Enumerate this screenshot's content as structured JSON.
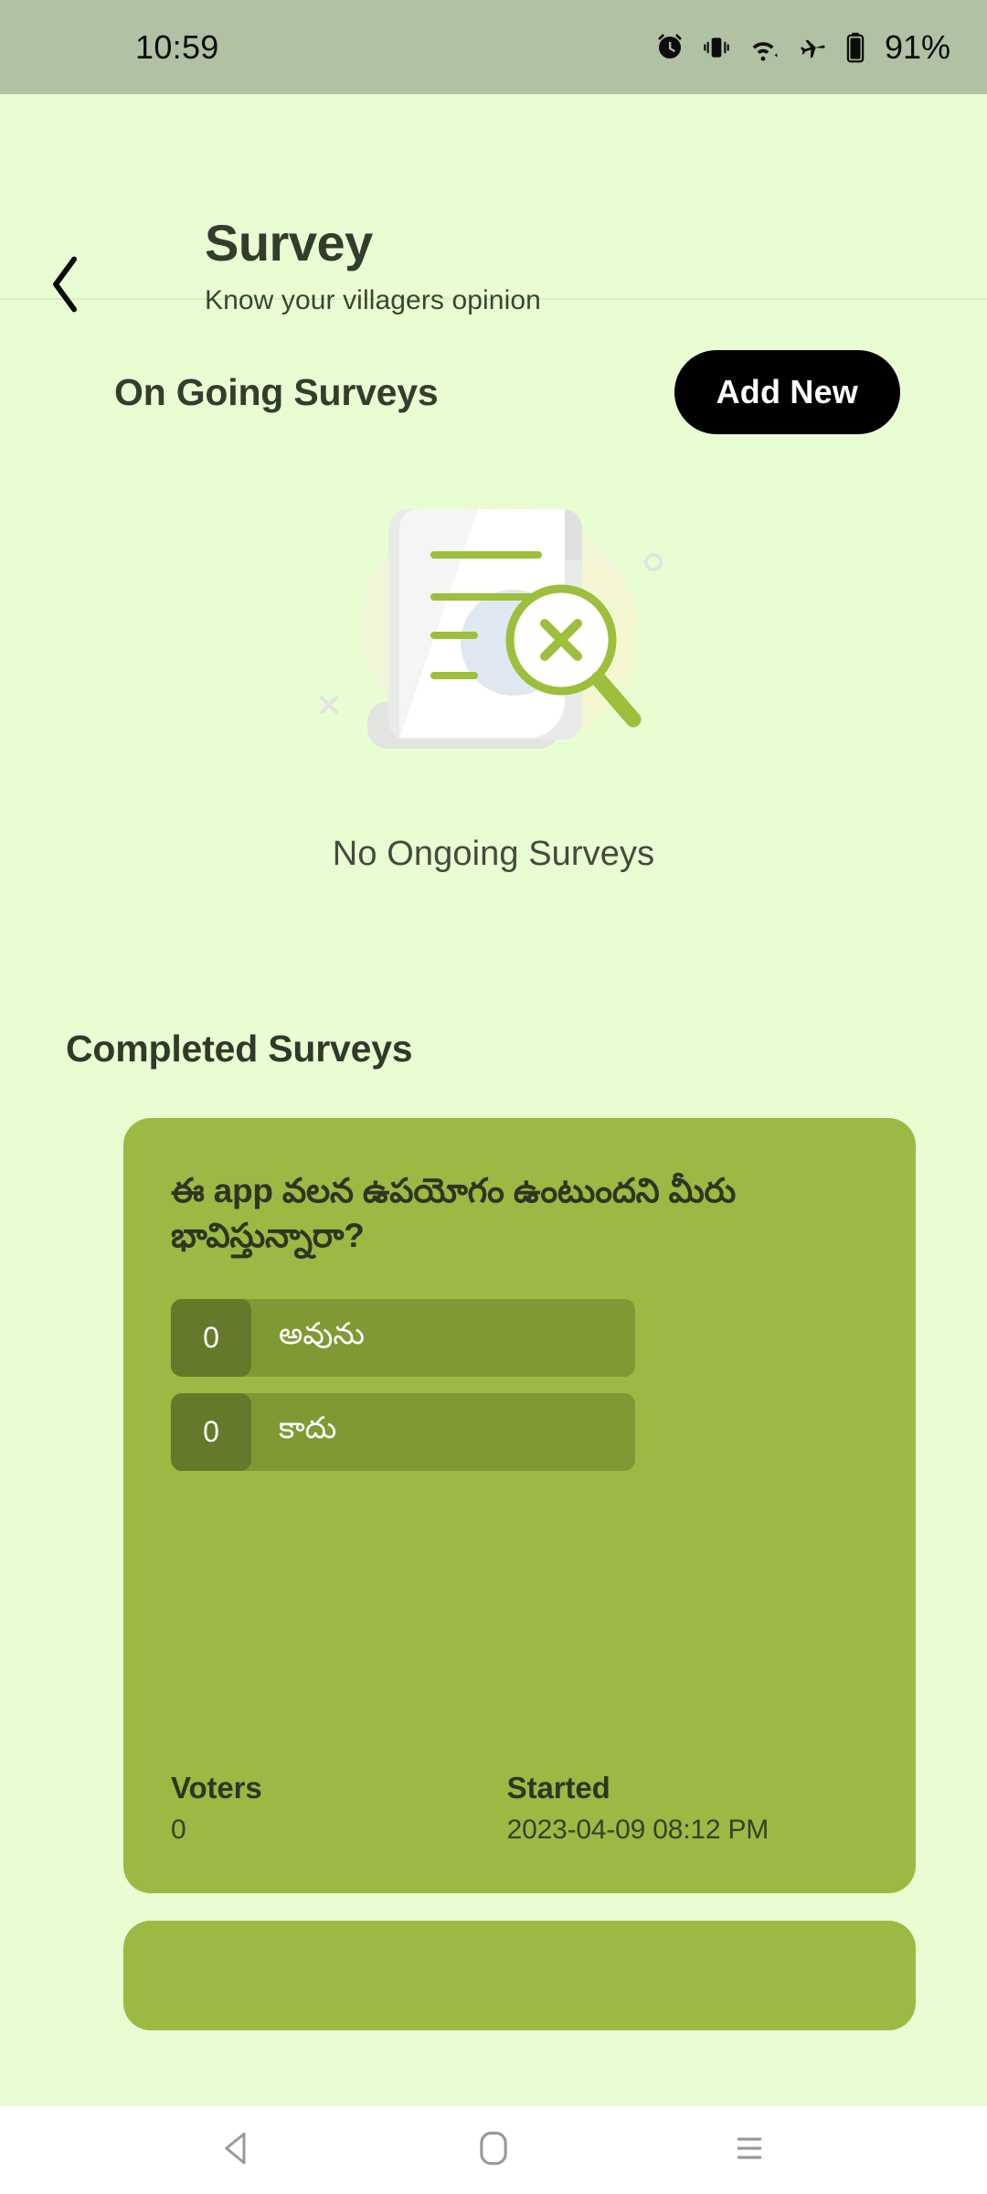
{
  "statusbar": {
    "time": "10:59",
    "battery": "91%",
    "icons": [
      "alarm-icon",
      "vibrate-icon",
      "wifi-icon",
      "airplane-icon",
      "battery-icon"
    ]
  },
  "header": {
    "back": "back-chevron-icon",
    "title": "Survey",
    "subtitle": "Know your villagers opinion"
  },
  "ongoing": {
    "section_title": "On Going Surveys",
    "add_new_label": "Add New",
    "empty_text": "No Ongoing Surveys",
    "empty_illustration": "document-search-not-found-icon"
  },
  "completed": {
    "section_title": "Completed Surveys",
    "cards": [
      {
        "question": "ఈ  app వలన ఉపయోగం ఉంటుందని మీరు భావిస్తున్నారా?",
        "options": [
          {
            "count": "0",
            "label": "అవును"
          },
          {
            "count": "0",
            "label": "కాదు"
          }
        ],
        "voters_label": "Voters",
        "voters_value": "0",
        "started_label": "Started",
        "started_value": "2023-04-09 08:12 PM"
      }
    ]
  },
  "navbar": {
    "back": "nav-back-icon",
    "home": "nav-home-icon",
    "recents": "nav-recents-icon"
  },
  "colors": {
    "page_bg": "#e9fdd3",
    "statusbar_bg": "#b0c1a4",
    "card_bg": "#9cb943",
    "option_bg": "#7f9a34",
    "count_bg": "#65792a",
    "accent_dark": "#333d2c",
    "button_bg": "#000000",
    "illustration_green": "#9cbf3c"
  }
}
